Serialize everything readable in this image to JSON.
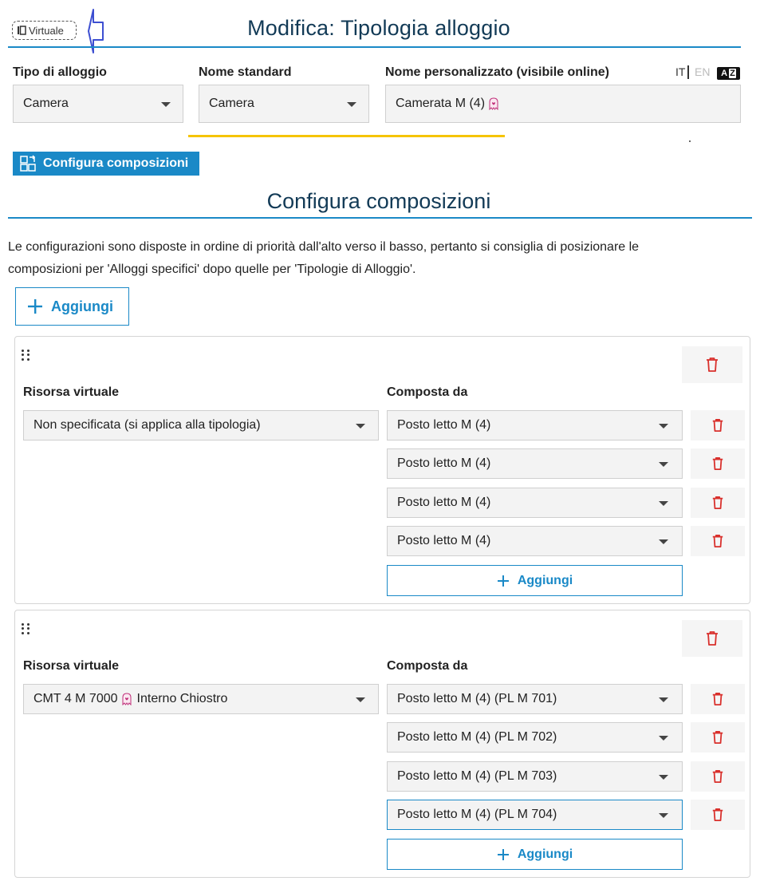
{
  "header": {
    "virtual_badge": "Virtuale",
    "title": "Modifica: Tipologia alloggio"
  },
  "fields": {
    "tipo": {
      "label": "Tipo di alloggio",
      "value": "Camera"
    },
    "nome_standard": {
      "label": "Nome standard",
      "value": "Camera"
    },
    "nome_personalizzato": {
      "label": "Nome personalizzato (visibile online)",
      "value": "Camerata M (4)"
    },
    "lang_it": "IT",
    "lang_en": "EN",
    "az_label": "A",
    "az_label_2": "Z"
  },
  "config_button": "Configura composizioni",
  "section": {
    "title": "Configura composizioni",
    "info_line1": "Le configurazioni sono disposte in ordine di priorità dall'alto verso il basso, pertanto si consiglia di posizionare le",
    "info_line2": "composizioni per 'Alloggi specifici' dopo quelle per 'Tipologie di Alloggio'.",
    "add_label": "Aggiungi"
  },
  "compositions": [
    {
      "risorsa_label": "Risorsa virtuale",
      "risorsa_value": "Non specificata (si applica alla tipologia)",
      "composta_label": "Composta da",
      "items": [
        "Posto letto M (4)",
        "Posto letto M (4)",
        "Posto letto M (4)",
        "Posto letto M (4)"
      ],
      "add_label": "Aggiungi"
    },
    {
      "risorsa_label": "Risorsa virtuale",
      "risorsa_value_pre": "CMT 4 M 7000",
      "risorsa_value_post": "Interno Chiostro",
      "composta_label": "Composta da",
      "items": [
        "Posto letto M (4) (PL M 701)",
        "Posto letto M (4) (PL M 702)",
        "Posto letto M (4) (PL M 703)",
        "Posto letto M (4) (PL M 704)"
      ],
      "add_label": "Aggiungi"
    }
  ],
  "colors": {
    "accent": "#1a89c7",
    "title": "#123a56",
    "highlight": "#f5c400",
    "danger": "#d9302c",
    "ghost": "#c0307a"
  }
}
